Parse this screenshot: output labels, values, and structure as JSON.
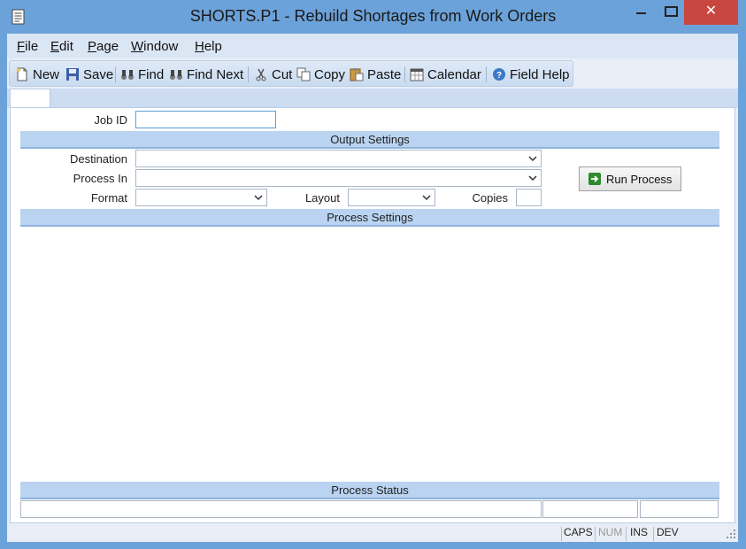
{
  "window": {
    "title": "SHORTS.P1 - Rebuild Shortages from Work Orders",
    "minimize": "—",
    "maximize": "☐",
    "close": "✕"
  },
  "menu": {
    "items": [
      {
        "label": "File",
        "u": "F",
        "rest": "ile"
      },
      {
        "label": "Edit",
        "u": "E",
        "rest": "dit"
      },
      {
        "label": "Page",
        "u": "P",
        "rest": "age"
      },
      {
        "label": "Window",
        "u": "W",
        "rest": "indow"
      },
      {
        "label": "Help",
        "u": "H",
        "rest": "elp"
      }
    ]
  },
  "toolbar": {
    "new": "New",
    "save": "Save",
    "find": "Find",
    "find_next": "Find Next",
    "cut": "Cut",
    "copy": "Copy",
    "paste": "Paste",
    "calendar": "Calendar",
    "field_help": "Field Help"
  },
  "form": {
    "job_id_label": "Job ID",
    "job_id_value": "",
    "output_settings": "Output Settings",
    "destination_label": "Destination",
    "destination_value": "",
    "process_in_label": "Process In",
    "process_in_value": "",
    "format_label": "Format",
    "format_value": "",
    "layout_label": "Layout",
    "layout_value": "",
    "copies_label": "Copies",
    "copies_value": "",
    "run_process": "Run Process",
    "process_settings": "Process Settings",
    "process_status": "Process Status"
  },
  "statusbar": {
    "caps": "CAPS",
    "num": "NUM",
    "ins": "INS",
    "dev": "DEV"
  }
}
